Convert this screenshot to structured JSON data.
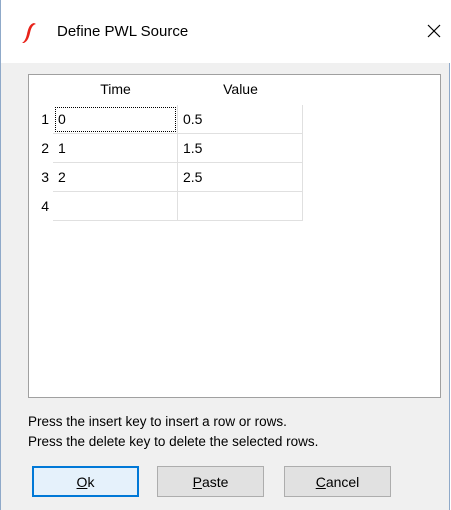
{
  "window": {
    "title": "Define PWL Source",
    "close_glyph": "✕",
    "icon": "app-logo-icon",
    "accent_color": "#e8231a"
  },
  "grid": {
    "columns": [
      "Time",
      "Value"
    ],
    "rows": [
      {
        "num": "1",
        "time": "0",
        "value": "0.5"
      },
      {
        "num": "2",
        "time": "1",
        "value": "1.5"
      },
      {
        "num": "3",
        "time": "2",
        "value": "2.5"
      },
      {
        "num": "4",
        "time": "",
        "value": ""
      }
    ]
  },
  "hints": {
    "insert": "Press the insert key to insert a row or rows.",
    "delete": "Press the delete key to delete the selected rows."
  },
  "buttons": {
    "ok": {
      "mnemonic": "O",
      "rest": "k"
    },
    "paste": {
      "mnemonic": "P",
      "rest": "aste"
    },
    "cancel": {
      "mnemonic": "C",
      "rest": "ancel"
    }
  }
}
